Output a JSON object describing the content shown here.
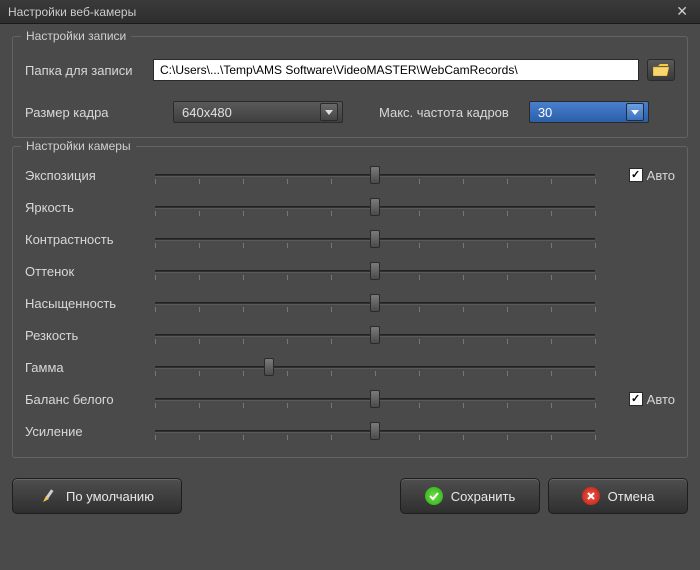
{
  "window": {
    "title": "Настройки веб-камеры"
  },
  "rec": {
    "group_title": "Настройки записи",
    "folder_label": "Папка для записи",
    "folder_value": "C:\\Users\\...\\Temp\\AMS Software\\VideoMASTER\\WebCamRecords\\",
    "size_label": "Размер кадра",
    "size_value": "640x480",
    "fps_label": "Макс. частота кадров",
    "fps_value": "30"
  },
  "cam": {
    "group_title": "Настройки камеры",
    "auto_label": "Авто",
    "sliders": [
      {
        "label": "Экспозиция",
        "pos": 50,
        "auto": true
      },
      {
        "label": "Яркость",
        "pos": 50
      },
      {
        "label": "Контрастность",
        "pos": 50
      },
      {
        "label": "Оттенок",
        "pos": 50
      },
      {
        "label": "Насыщенность",
        "pos": 50
      },
      {
        "label": "Резкость",
        "pos": 50
      },
      {
        "label": "Гамма",
        "pos": 26
      },
      {
        "label": "Баланс белого",
        "pos": 50,
        "auto": true
      },
      {
        "label": "Усиление",
        "pos": 50
      }
    ]
  },
  "buttons": {
    "defaults": "По умолчанию",
    "save": "Сохранить",
    "cancel": "Отмена"
  }
}
